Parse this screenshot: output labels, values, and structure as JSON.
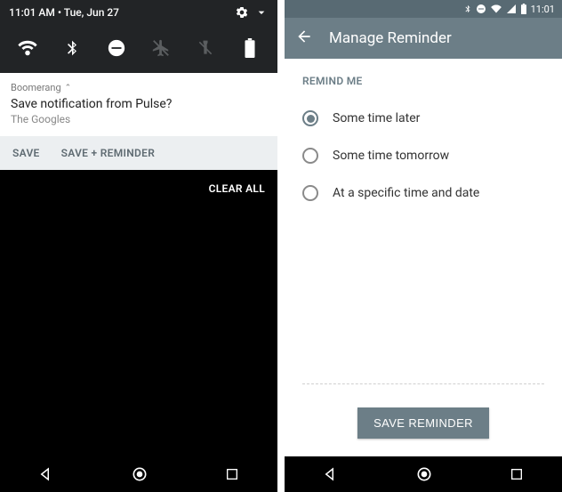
{
  "left": {
    "status": {
      "time_date": "11:01 AM • Tue, Jun 27"
    },
    "notification": {
      "app_name": "Boomerang",
      "title": "Save notification from Pulse?",
      "subtitle": "The Googles",
      "actions": {
        "save": "SAVE",
        "save_reminder": "SAVE + REMINDER"
      }
    },
    "clear_all": "CLEAR ALL"
  },
  "right": {
    "status": {
      "time": "11:01"
    },
    "toolbar": {
      "title": "Manage Reminder"
    },
    "section_label": "REMIND ME",
    "options": [
      {
        "label": "Some time later",
        "selected": true
      },
      {
        "label": "Some time tomorrow",
        "selected": false
      },
      {
        "label": "At a specific time and date",
        "selected": false
      }
    ],
    "save_button": "SAVE REMINDER"
  },
  "colors": {
    "accent": "#6c7e87"
  }
}
